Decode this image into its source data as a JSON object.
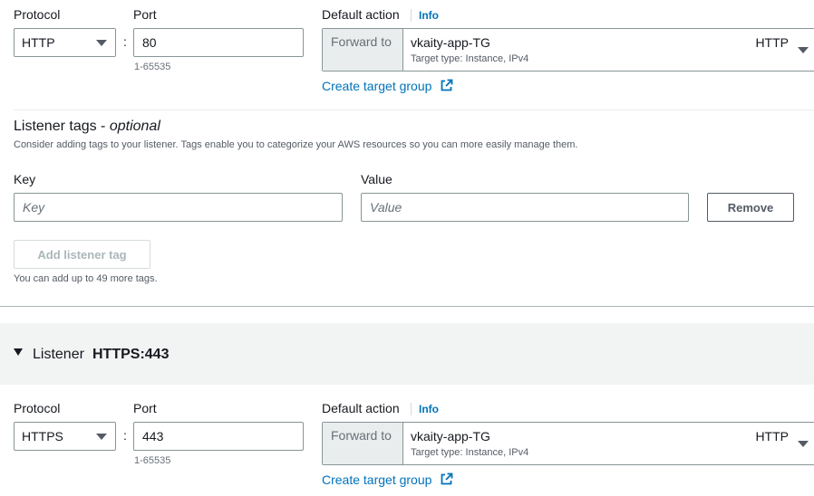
{
  "listener_http": {
    "protocol_label": "Protocol",
    "protocol_value": "HTTP",
    "port_label": "Port",
    "port_value": "80",
    "port_hint": "1-65535",
    "default_action_label": "Default action",
    "info_label": "Info",
    "forward_to_label": "Forward to",
    "target_group_name": "vkaity-app-TG",
    "target_group_sub": "Target type: Instance, IPv4",
    "target_group_protocol": "HTTP",
    "create_target_group_label": "Create target group"
  },
  "listener_tags": {
    "title": "Listener tags - ",
    "title_optional": "optional",
    "description": "Consider adding tags to your listener. Tags enable you to categorize your AWS resources so you can more easily manage them.",
    "key_label": "Key",
    "key_placeholder": "Key",
    "value_label": "Value",
    "value_placeholder": "Value",
    "remove_label": "Remove",
    "add_tag_label": "Add listener tag",
    "limit_text": "You can add up to 49 more tags."
  },
  "listener_https_header": {
    "prefix": "Listener",
    "name": "HTTPS:443"
  },
  "listener_https": {
    "protocol_label": "Protocol",
    "protocol_value": "HTTPS",
    "port_label": "Port",
    "port_value": "443",
    "port_hint": "1-65535",
    "default_action_label": "Default action",
    "info_label": "Info",
    "forward_to_label": "Forward to",
    "target_group_name": "vkaity-app-TG",
    "target_group_sub": "Target type: Instance, IPv4",
    "target_group_protocol": "HTTP",
    "create_target_group_label": "Create target group"
  },
  "colors": {
    "link": "#0073bb",
    "border": "#879596",
    "section_bg": "#f2f3f3"
  },
  "icons": [
    "caret-down-icon",
    "external-link-icon",
    "expand-triangle-icon"
  ]
}
